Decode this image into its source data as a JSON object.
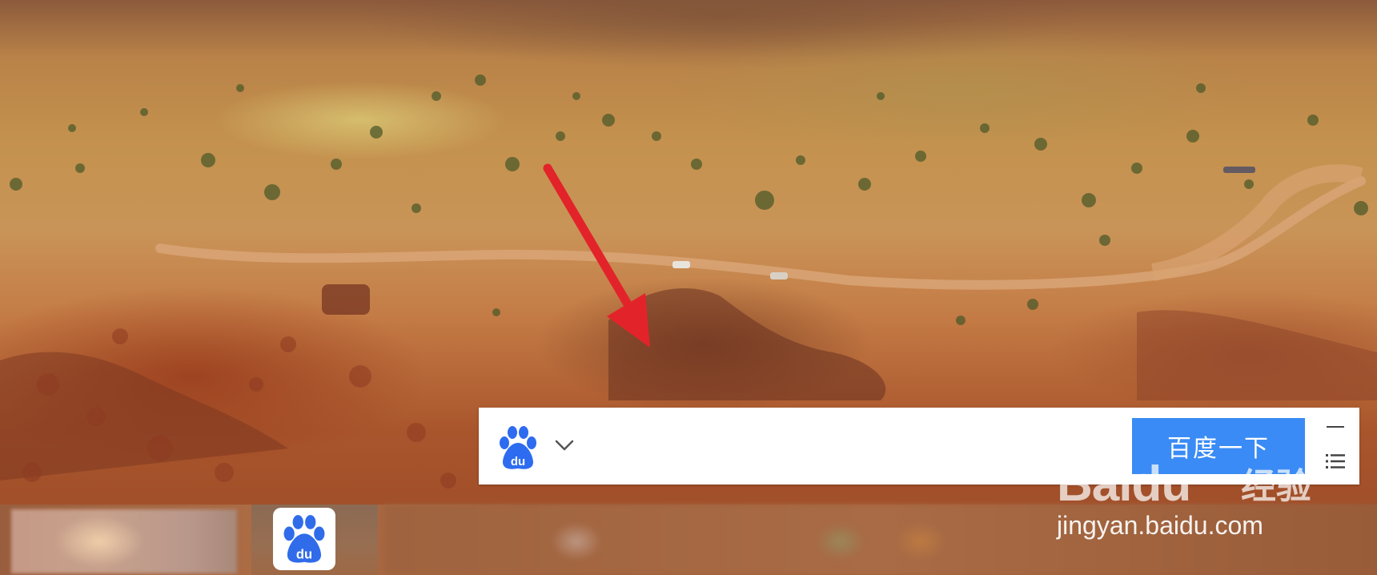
{
  "search_panel": {
    "search_query": "",
    "search_button_label": "百度一下"
  },
  "icons": {
    "panel_logo": "baidu-paw-logo-icon",
    "dropdown": "chevron-down-icon",
    "minimize": "minimize-icon",
    "menu": "list-menu-icon",
    "taskbar_app": "baidu-app-icon"
  },
  "watermark": {
    "logo_text": "Baidu",
    "cn_text": "经验",
    "url": "jingyan.baidu.com"
  },
  "colors": {
    "search_button": "#3a8bf5",
    "baidu_blue": "#2d6cf0",
    "annotation_arrow": "#e3232a"
  }
}
